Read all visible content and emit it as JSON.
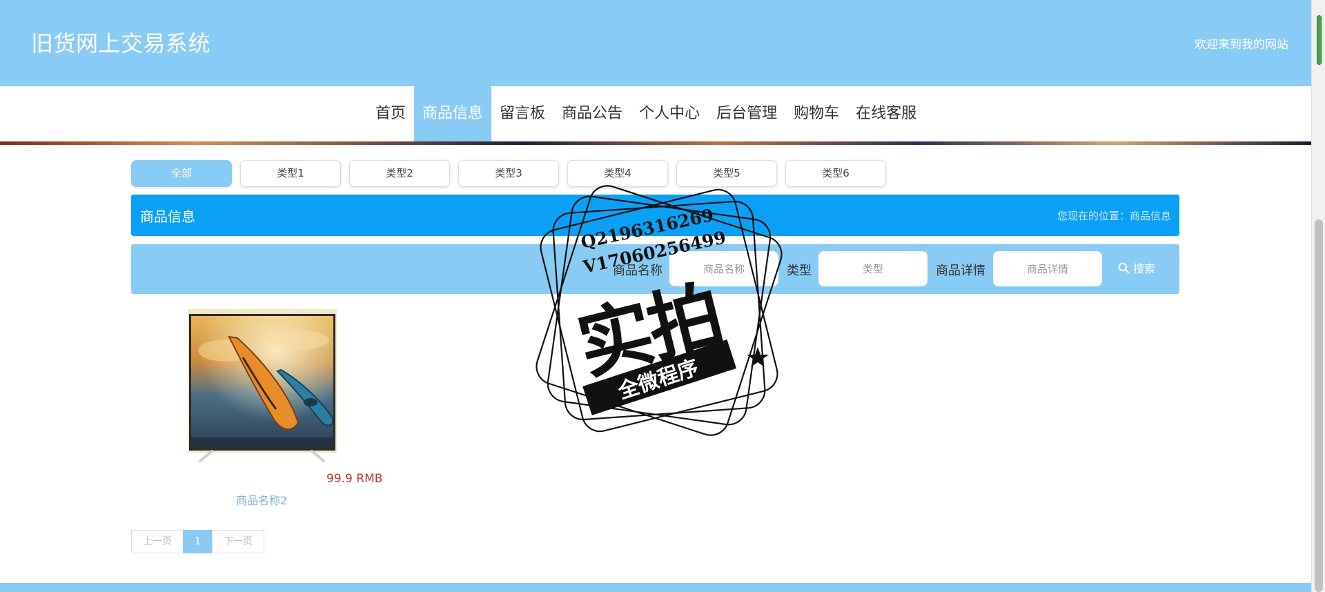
{
  "header": {
    "site_title": "旧货网上交易系统",
    "welcome": "欢迎来到我的网站"
  },
  "nav": {
    "items": [
      "首页",
      "商品信息",
      "留言板",
      "商品公告",
      "个人中心",
      "后台管理",
      "购物车",
      "在线客服"
    ],
    "active": "商品信息"
  },
  "categories": [
    "全部",
    "类型1",
    "类型2",
    "类型3",
    "类型4",
    "类型5",
    "类型6"
  ],
  "section": {
    "title": "商品信息",
    "breadcrumb": "您现在的位置：商品信息"
  },
  "search": {
    "name_label": "商品名称",
    "name_placeholder": "商品名称",
    "type_label": "类型",
    "type_placeholder": "类型",
    "detail_label": "商品详情",
    "detail_placeholder": "商品详情",
    "button_label": "搜索"
  },
  "products": [
    {
      "name": "商品名称2",
      "price": "99.9 RMB"
    }
  ],
  "pagination": {
    "prev": "上一页",
    "current": "1",
    "next": "下一页"
  },
  "watermark": {
    "line1": "Q2196316269",
    "line2": "V17060256499",
    "main": "实拍",
    "ribbon": "全微程序"
  },
  "colors": {
    "header_bg": "#88cbf5",
    "section_bar": "#0aa0f5",
    "price": "#c0392b",
    "product_name": "#7fb3d5"
  }
}
